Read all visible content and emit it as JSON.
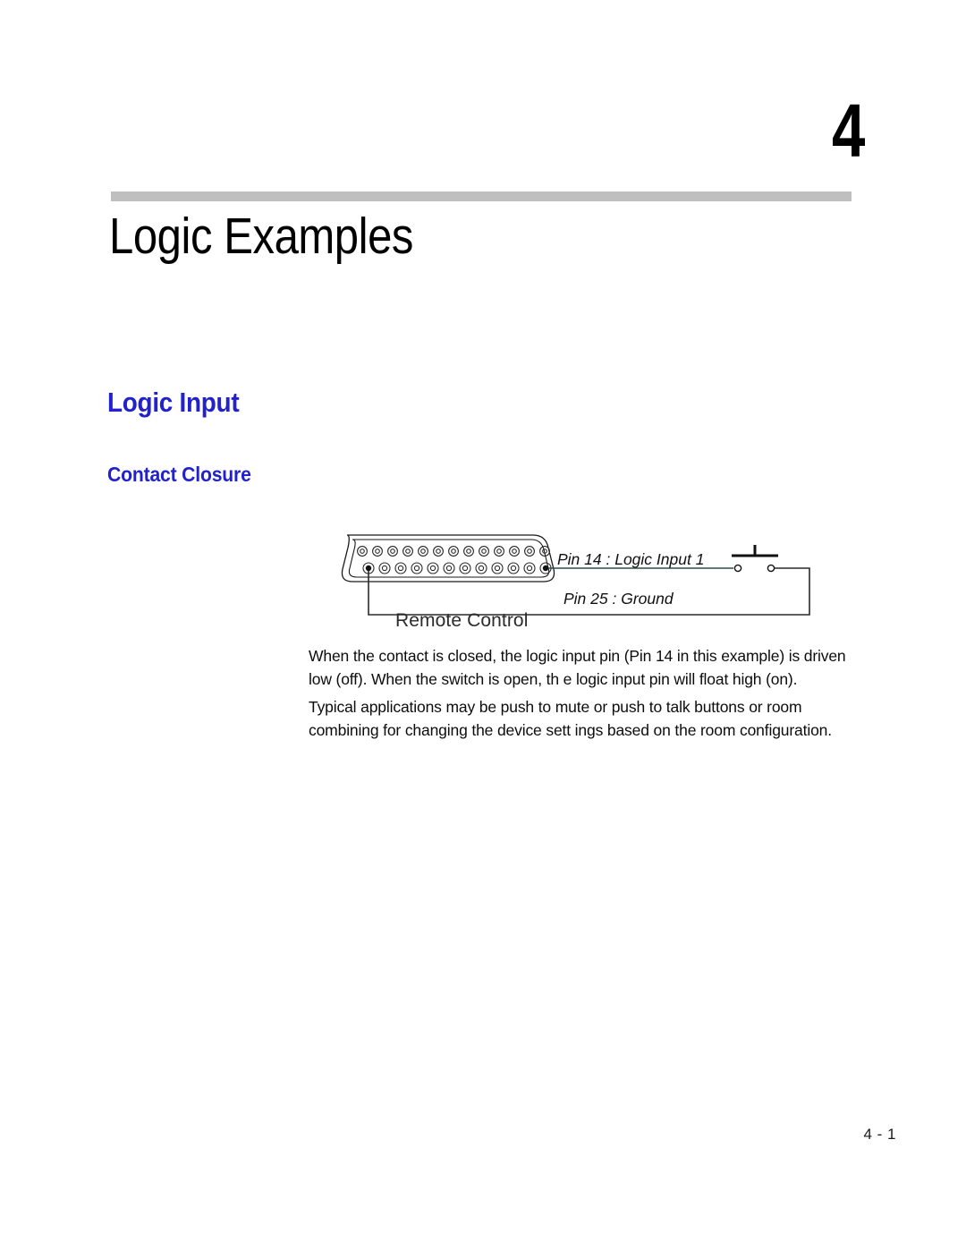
{
  "document": {
    "chapter_number": "4",
    "chapter_title": "Logic Examples",
    "page_footer": "4 - 1"
  },
  "sections": {
    "heading_1": "Logic Input",
    "heading_2": "Contact Closure"
  },
  "figure": {
    "caption": "Remote Control",
    "connector_type": "DB-25 D-sub connector",
    "top_row_pins": 13,
    "bottom_row_pins": 12,
    "labels": {
      "signal": "Pin 14 : Logic Input 1",
      "ground": "Pin 25 : Ground"
    },
    "switch_symbol": "push-button-switch"
  },
  "body": {
    "paragraph_1": "When the contact is closed, the logic input pin (Pin 14 in this example) is driven low (off).  When the switch is open, th e logic input pin will float high (on).",
    "paragraph_2": "Typical applications may be push to mute or push to talk buttons or room combining for changing the device sett ings based on the room configuration."
  },
  "colors": {
    "heading_blue": "#2222cc",
    "rule_gray": "#bfbfbf",
    "body_black": "#0d0d0d"
  }
}
